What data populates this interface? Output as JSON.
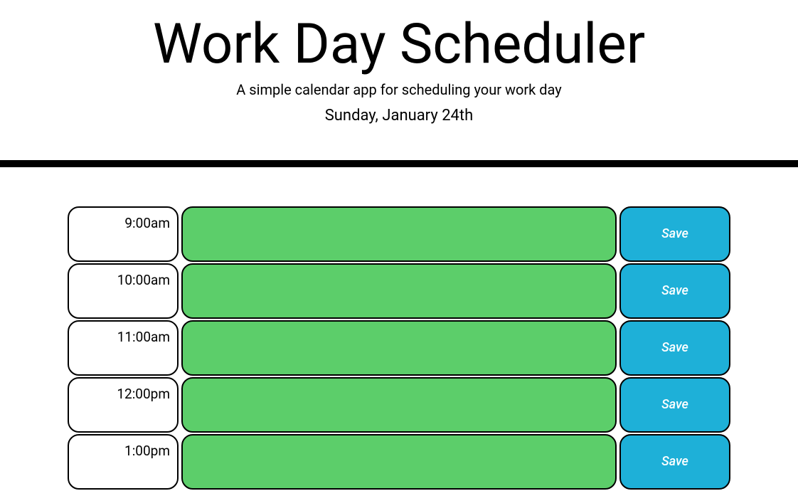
{
  "header": {
    "title": "Work Day Scheduler",
    "subtitle": "A simple calendar app for scheduling your work day",
    "currentDate": "Sunday, January 24th"
  },
  "timeSlots": [
    {
      "hour": "9:00am",
      "task": "",
      "saveLabel": "Save"
    },
    {
      "hour": "10:00am",
      "task": "",
      "saveLabel": "Save"
    },
    {
      "hour": "11:00am",
      "task": "",
      "saveLabel": "Save"
    },
    {
      "hour": "12:00pm",
      "task": "",
      "saveLabel": "Save"
    },
    {
      "hour": "1:00pm",
      "task": "",
      "saveLabel": "Save"
    }
  ],
  "colors": {
    "taskBackground": "#5cce6a",
    "saveBackground": "#1eb0d8",
    "border": "#000000"
  }
}
